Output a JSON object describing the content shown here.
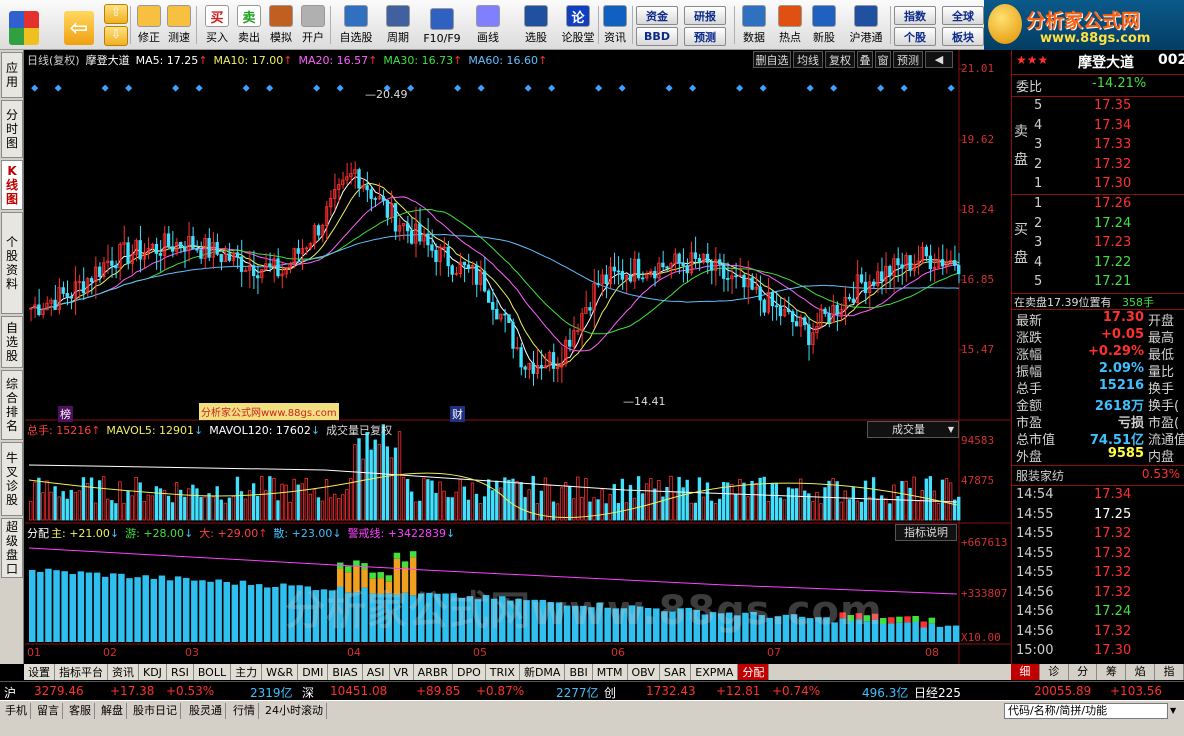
{
  "toolbar": {
    "buttons": [
      {
        "label": "修正",
        "icon": "refresh-icon"
      },
      {
        "label": "测速",
        "icon": "clock-icon"
      },
      {
        "label": "买入",
        "icon": "buy-icon",
        "glyph": "买"
      },
      {
        "label": "卖出",
        "icon": "sell-icon",
        "glyph": "卖"
      },
      {
        "label": "模拟",
        "icon": "hammer-icon"
      },
      {
        "label": "开户",
        "icon": "lock-icon"
      },
      {
        "label": "自选股",
        "icon": "star-list-icon"
      },
      {
        "label": "周期",
        "icon": "period-icon"
      },
      {
        "label": "F10/F9",
        "icon": "f10-icon"
      },
      {
        "label": "画线",
        "icon": "pen-icon"
      },
      {
        "label": "选股",
        "icon": "filter-icon"
      },
      {
        "label": "论股堂",
        "icon": "forum-icon",
        "glyph": "论"
      },
      {
        "label": "资讯",
        "icon": "news-icon"
      },
      {
        "label": "数据",
        "icon": "data-icon"
      },
      {
        "label": "热点",
        "icon": "hot-icon"
      },
      {
        "label": "新股",
        "icon": "ipo-icon"
      },
      {
        "label": "沪港通",
        "icon": "sse-hkex-icon"
      }
    ],
    "small_buttons": [
      "资金",
      "研报",
      "指数",
      "全球",
      "BBD",
      "预测",
      "个股",
      "板块"
    ]
  },
  "logo": {
    "title": "分析家公式网",
    "url": "www.88gs.com"
  },
  "left_tabs": [
    "应用",
    "分时图",
    "K线图",
    "个股资料",
    "自选股",
    "综合排名",
    "牛叉诊股",
    "超级盘口"
  ],
  "chart": {
    "header": {
      "period": "日线(复权)",
      "stock": "摩登大道",
      "ma5": "MA5: 17.25",
      "ma10": "MA10: 17.00",
      "ma20": "MA20: 16.57",
      "ma30": "MA30: 16.73",
      "ma60": "MA60: 16.60"
    },
    "buttons": [
      "删自选",
      "均线",
      "复权",
      "叠",
      "窗",
      "预测"
    ],
    "price_labels": [
      "21.01",
      "19.62",
      "18.24",
      "16.85",
      "15.47"
    ],
    "high_label": "20.49",
    "low_label": "14.41",
    "markers": {
      "bang": "榜",
      "cai": "财"
    },
    "watermark_small": "分析家公式网www.88gs.com",
    "volume_header": {
      "total": "总手: 15216",
      "mavol5": "MAVOL5: 12901",
      "mavol120": "MAVOL120: 17602",
      "note": "成交量已复权"
    },
    "volume_select": "成交量",
    "volume_labels": [
      "94583",
      "47875"
    ],
    "alloc_header": {
      "name": "分配",
      "main": "主: +21.00",
      "you": "游: +28.00",
      "da": "大: +29.00",
      "san": "散: +23.00",
      "alert": "警戒线: +3422839"
    },
    "alloc_button": "指标说明",
    "alloc_labels": [
      "+667613",
      "+333807",
      "X10.00"
    ],
    "watermark_big": "分析家公式网www.88gs.com",
    "months": [
      "01",
      "02",
      "03",
      "04",
      "05",
      "06",
      "07",
      "08"
    ]
  },
  "chart_data": {
    "type": "candlestick",
    "title": "摩登大道",
    "x": [
      "01",
      "02",
      "03",
      "04",
      "05",
      "06",
      "07",
      "08"
    ],
    "high": 20.49,
    "low": 14.41,
    "ma": {
      "MA5": 17.25,
      "MA10": 17.0,
      "MA20": 16.57,
      "MA30": 16.73,
      "MA60": 16.6
    },
    "ylim": [
      15.47,
      21.01
    ],
    "volume": {
      "total": 15216,
      "MAVOL5": 12901,
      "MAVOL120": 17602,
      "ylim": [
        0,
        94583
      ]
    }
  },
  "bottom_tabs": [
    "设置",
    "指标平台",
    "资讯",
    "KDJ",
    "RSI",
    "BOLL",
    "主力",
    "W&R",
    "DMI",
    "BIAS",
    "ASI",
    "VR",
    "ARBR",
    "DPO",
    "TRIX",
    "新DMA",
    "BBI",
    "MTM",
    "OBV",
    "SAR",
    "EXPMA",
    "分配"
  ],
  "right": {
    "title": "摩登大道",
    "code": "002",
    "stars": "★★★",
    "weibi_label": "委比",
    "weibi": "-14.21%",
    "sell_label": "卖盘",
    "buy_label": "买盘",
    "sell": [
      {
        "lvl": "5",
        "price": "17.35"
      },
      {
        "lvl": "4",
        "price": "17.34"
      },
      {
        "lvl": "3",
        "price": "17.33"
      },
      {
        "lvl": "2",
        "price": "17.32"
      },
      {
        "lvl": "1",
        "price": "17.30"
      }
    ],
    "buy": [
      {
        "lvl": "1",
        "price": "17.26"
      },
      {
        "lvl": "2",
        "price": "17.24"
      },
      {
        "lvl": "3",
        "price": "17.23"
      },
      {
        "lvl": "4",
        "price": "17.22"
      },
      {
        "lvl": "5",
        "price": "17.21"
      }
    ],
    "notice": "在卖盘17.39位置有",
    "notice_vol": "358手",
    "stats": [
      {
        "k": "最新",
        "v": "17.30",
        "k2": "开盘",
        "col": "#ff3030"
      },
      {
        "k": "涨跌",
        "v": "+0.05",
        "k2": "最高",
        "col": "#ff3030"
      },
      {
        "k": "涨幅",
        "v": "+0.29%",
        "k2": "最低",
        "col": "#ff3030"
      },
      {
        "k": "振幅",
        "v": "2.09%",
        "k2": "量比",
        "col": "#40c0ff"
      },
      {
        "k": "总手",
        "v": "15216",
        "k2": "换手",
        "col": "#40c0ff"
      },
      {
        "k": "金额",
        "v": "2618万",
        "k2": "换手(",
        "col": "#40c0ff"
      },
      {
        "k": "市盈",
        "v": "亏损",
        "k2": "市盈(",
        "col": "#d0d0d0"
      },
      {
        "k": "总市值",
        "v": "74.51亿",
        "k2": "流通值",
        "col": "#40c0ff"
      },
      {
        "k": "外盘",
        "v": "9585",
        "k2": "内盘",
        "col": "#ffff40"
      }
    ],
    "industry": "服装家纺",
    "industry_pct": "0.53%",
    "ticks": [
      {
        "t": "14:54",
        "p": "17.34"
      },
      {
        "t": "14:55",
        "p": "17.25"
      },
      {
        "t": "14:55",
        "p": "17.32"
      },
      {
        "t": "14:55",
        "p": "17.32"
      },
      {
        "t": "14:55",
        "p": "17.32"
      },
      {
        "t": "14:56",
        "p": "17.32"
      },
      {
        "t": "14:56",
        "p": "17.24"
      },
      {
        "t": "14:56",
        "p": "17.32"
      },
      {
        "t": "15:00",
        "p": "17.30"
      }
    ],
    "tabs": [
      "细",
      "诊",
      "分",
      "筹",
      "焰",
      "指"
    ]
  },
  "index_bar": {
    "sh_name": "沪",
    "sh_val": "3279.46",
    "sh_chg": "+17.38",
    "sh_pct": "+0.53%",
    "sh_amt": "2319亿",
    "sz_name": "深",
    "sz_val": "10451.08",
    "sz_chg": "+89.85",
    "sz_pct": "+0.87%",
    "sz_amt": "2277亿",
    "cy_name": "创",
    "cy_val": "1732.43",
    "cy_chg": "+12.81",
    "cy_pct": "+0.74%",
    "cy_amt": "496.3亿",
    "nk_name": "日经225",
    "nk_val": "20055.89",
    "nk_chg": "+103.56"
  },
  "status_bar": {
    "items": [
      "手机",
      "留言",
      "客服",
      "解盘",
      "股市日记",
      "股灵通",
      "行情",
      "24小时滚动"
    ],
    "code_placeholder": "代码/名称/简拼/功能"
  }
}
